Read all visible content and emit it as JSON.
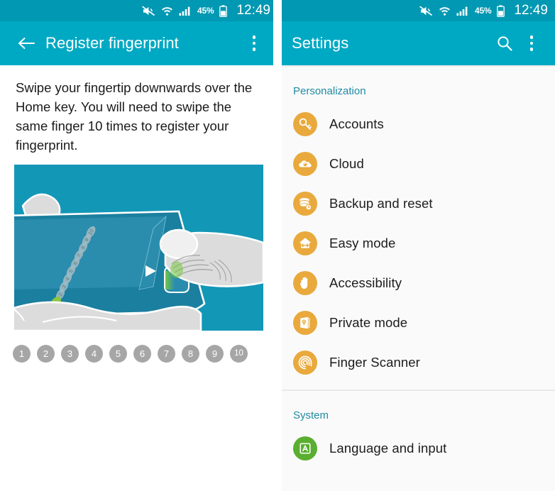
{
  "statusbar": {
    "battery_percent": "45%",
    "time": "12:49",
    "icons": [
      "mute-icon",
      "wifi-icon",
      "signal-icon",
      "battery-icon"
    ]
  },
  "left_screen": {
    "appbar": {
      "title": "Register fingerprint",
      "back_icon": "back-arrow-icon",
      "overflow_icon": "overflow-menu-icon"
    },
    "instructions": "Swipe your fingertip downwards over the Home key. You will need to swipe the same finger 10 times to register your fingerprint.",
    "illustration": {
      "name": "fingerprint-swipe-illustration",
      "marker_numbers": [
        "10",
        "9",
        "8",
        "7",
        "6",
        "5",
        "4",
        "3",
        "2",
        "1"
      ],
      "background_color": "#1397b7",
      "phone_color": "#1b7fa0",
      "hand_color": "#dcdcdc",
      "highlight_color": "#7ab51d"
    },
    "steps": [
      "1",
      "2",
      "3",
      "4",
      "5",
      "6",
      "7",
      "8",
      "9",
      "10"
    ],
    "step_color": "#a6a6a6"
  },
  "right_screen": {
    "appbar": {
      "title": "Settings",
      "search_icon": "search-icon",
      "overflow_icon": "overflow-menu-icon"
    },
    "sections": [
      {
        "label": "Personalization",
        "items": [
          {
            "label": "Accounts",
            "icon": "key-icon",
            "color": "#e9a93c"
          },
          {
            "label": "Cloud",
            "icon": "cloud-icon",
            "color": "#e9a93c"
          },
          {
            "label": "Backup and reset",
            "icon": "database-icon",
            "color": "#e9a93c"
          },
          {
            "label": "Easy mode",
            "icon": "home-swap-icon",
            "color": "#e9a93c"
          },
          {
            "label": "Accessibility",
            "icon": "hand-icon",
            "color": "#e9a93c"
          },
          {
            "label": "Private mode",
            "icon": "lock-folder-icon",
            "color": "#e9a93c"
          },
          {
            "label": "Finger Scanner",
            "icon": "fingerprint-icon",
            "color": "#e9a93c"
          }
        ]
      },
      {
        "label": "System",
        "items": [
          {
            "label": "Language and input",
            "icon": "letter-a-icon",
            "color": "#5bae30"
          }
        ]
      }
    ]
  },
  "colors": {
    "statusbar": "#0098b2",
    "appbar": "#00a9c3",
    "section_label": "#1f8ba3",
    "list_bg": "#fafafa"
  }
}
